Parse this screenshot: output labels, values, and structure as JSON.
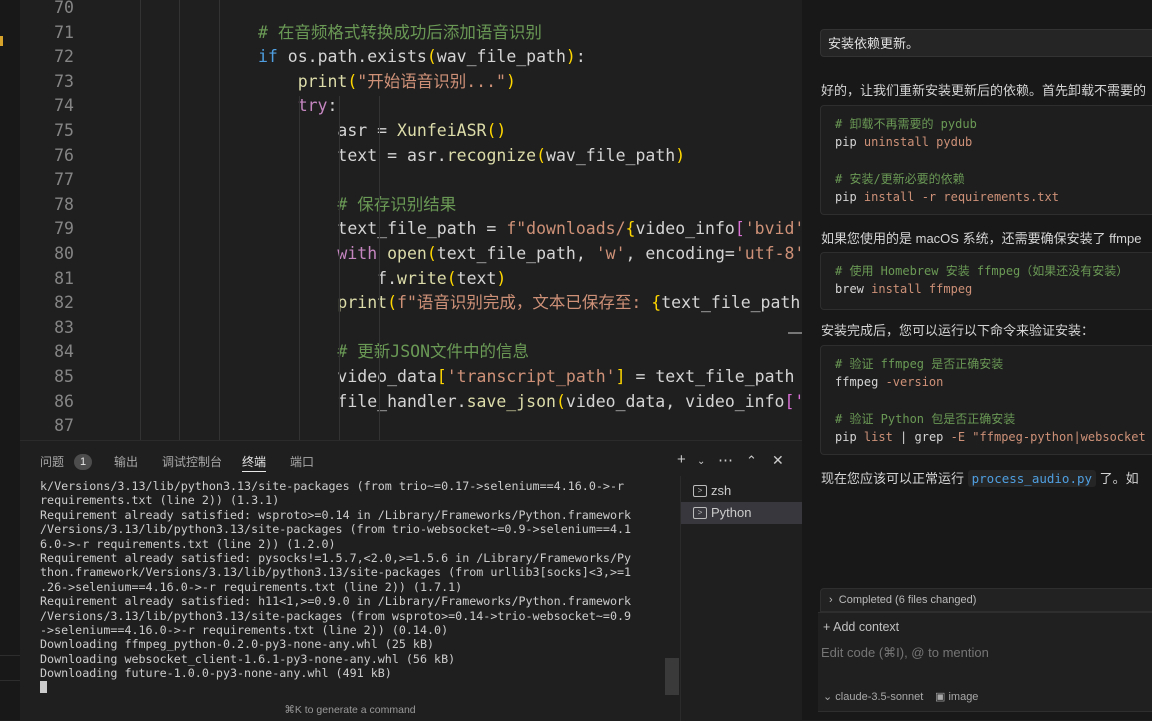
{
  "editor": {
    "lines": [
      {
        "n": "70",
        "tokens": []
      },
      {
        "n": "71",
        "indent": "                ",
        "tokens": [
          {
            "t": "# 在音频格式转换成功后添加语音识别",
            "c": "c-cm"
          }
        ]
      },
      {
        "n": "72",
        "indent": "                ",
        "tokens": [
          {
            "t": "if",
            "c": "c-kw"
          },
          {
            "t": " os.path.exists",
            "c": "c-var"
          },
          {
            "t": "(",
            "c": "c-br1"
          },
          {
            "t": "wav_file_path",
            "c": "c-var"
          },
          {
            "t": ")",
            "c": "c-br1"
          },
          {
            "t": ":",
            "c": "c-var"
          }
        ]
      },
      {
        "n": "73",
        "indent": "                    ",
        "tokens": [
          {
            "t": "print",
            "c": "c-fn"
          },
          {
            "t": "(",
            "c": "c-br1"
          },
          {
            "t": "\"开始语音识别...\"",
            "c": "c-str"
          },
          {
            "t": ")",
            "c": "c-br1"
          }
        ]
      },
      {
        "n": "74",
        "indent": "                    ",
        "tokens": [
          {
            "t": "try",
            "c": "c-kw2"
          },
          {
            "t": ":",
            "c": "c-var"
          }
        ]
      },
      {
        "n": "75",
        "indent": "                        ",
        "tokens": [
          {
            "t": "asr = ",
            "c": "c-var"
          },
          {
            "t": "XunfeiASR",
            "c": "c-cls"
          },
          {
            "t": "()",
            "c": "c-br1"
          }
        ]
      },
      {
        "n": "76",
        "indent": "                        ",
        "tokens": [
          {
            "t": "text = asr.",
            "c": "c-var"
          },
          {
            "t": "recognize",
            "c": "c-fn"
          },
          {
            "t": "(",
            "c": "c-br1"
          },
          {
            "t": "wav_file_path",
            "c": "c-var"
          },
          {
            "t": ")",
            "c": "c-br1"
          }
        ]
      },
      {
        "n": "77",
        "tokens": []
      },
      {
        "n": "78",
        "indent": "                        ",
        "tokens": [
          {
            "t": "# 保存识别结果",
            "c": "c-cm"
          }
        ]
      },
      {
        "n": "79",
        "indent": "                        ",
        "tokens": [
          {
            "t": "text_file_path = ",
            "c": "c-var"
          },
          {
            "t": "f\"downloads/",
            "c": "c-str"
          },
          {
            "t": "{",
            "c": "c-br1"
          },
          {
            "t": "video_info",
            "c": "c-var"
          },
          {
            "t": "[",
            "c": "c-br2"
          },
          {
            "t": "'bvid'",
            "c": "c-str"
          }
        ]
      },
      {
        "n": "80",
        "indent": "                        ",
        "tokens": [
          {
            "t": "with",
            "c": "c-kw2"
          },
          {
            "t": " open",
            "c": "c-fn"
          },
          {
            "t": "(",
            "c": "c-br1"
          },
          {
            "t": "text_file_path, ",
            "c": "c-var"
          },
          {
            "t": "'w'",
            "c": "c-str"
          },
          {
            "t": ", encoding=",
            "c": "c-var"
          },
          {
            "t": "'utf-8'",
            "c": "c-str"
          }
        ]
      },
      {
        "n": "81",
        "indent": "                            ",
        "tokens": [
          {
            "t": "f.",
            "c": "c-var"
          },
          {
            "t": "write",
            "c": "c-fn"
          },
          {
            "t": "(",
            "c": "c-br1"
          },
          {
            "t": "text",
            "c": "c-var"
          },
          {
            "t": ")",
            "c": "c-br1"
          }
        ]
      },
      {
        "n": "82",
        "indent": "                        ",
        "tokens": [
          {
            "t": "print",
            "c": "c-fn"
          },
          {
            "t": "(",
            "c": "c-br1"
          },
          {
            "t": "f\"语音识别完成，文本已保存至: ",
            "c": "c-str"
          },
          {
            "t": "{",
            "c": "c-br1"
          },
          {
            "t": "text_file_path",
            "c": "c-var"
          },
          {
            "t": "}",
            "c": "c-br1"
          }
        ]
      },
      {
        "n": "83",
        "tokens": []
      },
      {
        "n": "84",
        "indent": "                        ",
        "tokens": [
          {
            "t": "# 更新JSON文件中的信息",
            "c": "c-cm"
          }
        ]
      },
      {
        "n": "85",
        "indent": "                        ",
        "tokens": [
          {
            "t": "video_data",
            "c": "c-var"
          },
          {
            "t": "[",
            "c": "c-br1"
          },
          {
            "t": "'transcript_path'",
            "c": "c-str"
          },
          {
            "t": "]",
            "c": "c-br1"
          },
          {
            "t": " = text_file_path",
            "c": "c-var"
          }
        ]
      },
      {
        "n": "86",
        "indent": "                        ",
        "tokens": [
          {
            "t": "file_handler.",
            "c": "c-var"
          },
          {
            "t": "save_json",
            "c": "c-fn"
          },
          {
            "t": "(",
            "c": "c-br1"
          },
          {
            "t": "video_data, video_info",
            "c": "c-var"
          },
          {
            "t": "['",
            "c": "c-br2"
          }
        ]
      },
      {
        "n": "87",
        "tokens": []
      }
    ]
  },
  "panel": {
    "tabs": [
      {
        "label": "问题",
        "active": false
      },
      {
        "label": "输出",
        "active": false
      },
      {
        "label": "调试控制台",
        "active": false
      },
      {
        "label": "终端",
        "active": true
      },
      {
        "label": "端口",
        "active": false
      }
    ],
    "problems_count": "1",
    "icons": {
      "add": "plus-icon",
      "dropdown": "chevron-down-icon",
      "more": "ellipsis-icon",
      "maximize": "chevron-up-icon",
      "close": "close-icon"
    },
    "terminal_lines": [
      "k/Versions/3.13/lib/python3.13/site-packages (from trio~=0.17->selenium==4.16.0->-r",
      "requirements.txt (line 2)) (1.3.1)",
      "Requirement already satisfied: wsproto>=0.14 in /Library/Frameworks/Python.framework",
      "/Versions/3.13/lib/python3.13/site-packages (from trio-websocket~=0.9->selenium==4.1",
      "6.0->-r requirements.txt (line 2)) (1.2.0)",
      "Requirement already satisfied: pysocks!=1.5.7,<2.0,>=1.5.6 in /Library/Frameworks/Py",
      "thon.framework/Versions/3.13/lib/python3.13/site-packages (from urllib3[socks]<3,>=1",
      ".26->selenium==4.16.0->-r requirements.txt (line 2)) (1.7.1)",
      "Requirement already satisfied: h11<1,>=0.9.0 in /Library/Frameworks/Python.framework",
      "/Versions/3.13/lib/python3.13/site-packages (from wsproto>=0.14->trio-websocket~=0.9",
      "->selenium==4.16.0->-r requirements.txt (line 2)) (0.14.0)",
      "Downloading ffmpeg_python-0.2.0-py3-none-any.whl (25 kB)",
      "Downloading websocket_client-1.6.1-py3-none-any.whl (56 kB)",
      "Downloading future-1.0.0-py3-none-any.whl (491 kB)"
    ],
    "hint": "⌘K to generate a command",
    "terminals": [
      {
        "label": "zsh",
        "selected": false
      },
      {
        "label": "Python",
        "selected": true
      }
    ]
  },
  "chat": {
    "user_message": "安装依赖更新。",
    "para1": "好的，让我们重新安装更新后的依赖。首先卸载不需要的",
    "block1": [
      [
        {
          "t": "# 卸载不再需要的 pydub",
          "c": "c-cm"
        }
      ],
      [
        {
          "t": "pip ",
          "c": "c-var"
        },
        {
          "t": "uninstall pydub",
          "c": "c-str"
        }
      ],
      [],
      [
        {
          "t": "# 安装/更新必要的依赖",
          "c": "c-cm"
        }
      ],
      [
        {
          "t": "pip ",
          "c": "c-var"
        },
        {
          "t": "install -r requirements.txt",
          "c": "c-str"
        }
      ]
    ],
    "para2": "如果您使用的是 macOS 系统，还需要确保安装了 ffmpe",
    "block2": [
      [
        {
          "t": "# 使用 Homebrew 安装 ffmpeg（如果还没有安装）",
          "c": "c-cm"
        }
      ],
      [
        {
          "t": "brew ",
          "c": "c-var"
        },
        {
          "t": "install ffmpeg",
          "c": "c-str"
        }
      ]
    ],
    "para3": "安装完成后，您可以运行以下命令来验证安装：",
    "block3": [
      [
        {
          "t": "# 验证 ffmpeg 是否正确安装",
          "c": "c-cm"
        }
      ],
      [
        {
          "t": "ffmpeg ",
          "c": "c-var"
        },
        {
          "t": "-version",
          "c": "c-str"
        }
      ],
      [],
      [
        {
          "t": "# 验证 Python 包是否正确安装",
          "c": "c-cm"
        }
      ],
      [
        {
          "t": "pip ",
          "c": "c-var"
        },
        {
          "t": "list",
          "c": "c-str"
        },
        {
          "t": " | ",
          "c": "c-var"
        },
        {
          "t": "grep",
          "c": "c-var"
        },
        {
          "t": " -E \"ffmpeg-python|websocket",
          "c": "c-str"
        }
      ]
    ],
    "para4_before": "现在您应该可以正常运行 ",
    "para4_code": "process_audio.py",
    "para4_after": " 了。如",
    "completed": "Completed (6 files changed)",
    "add_context": "Add context",
    "input_placeholder": "Edit code (⌘I), @ to mention",
    "model": "claude-3.5-sonnet",
    "image_label": "image"
  }
}
